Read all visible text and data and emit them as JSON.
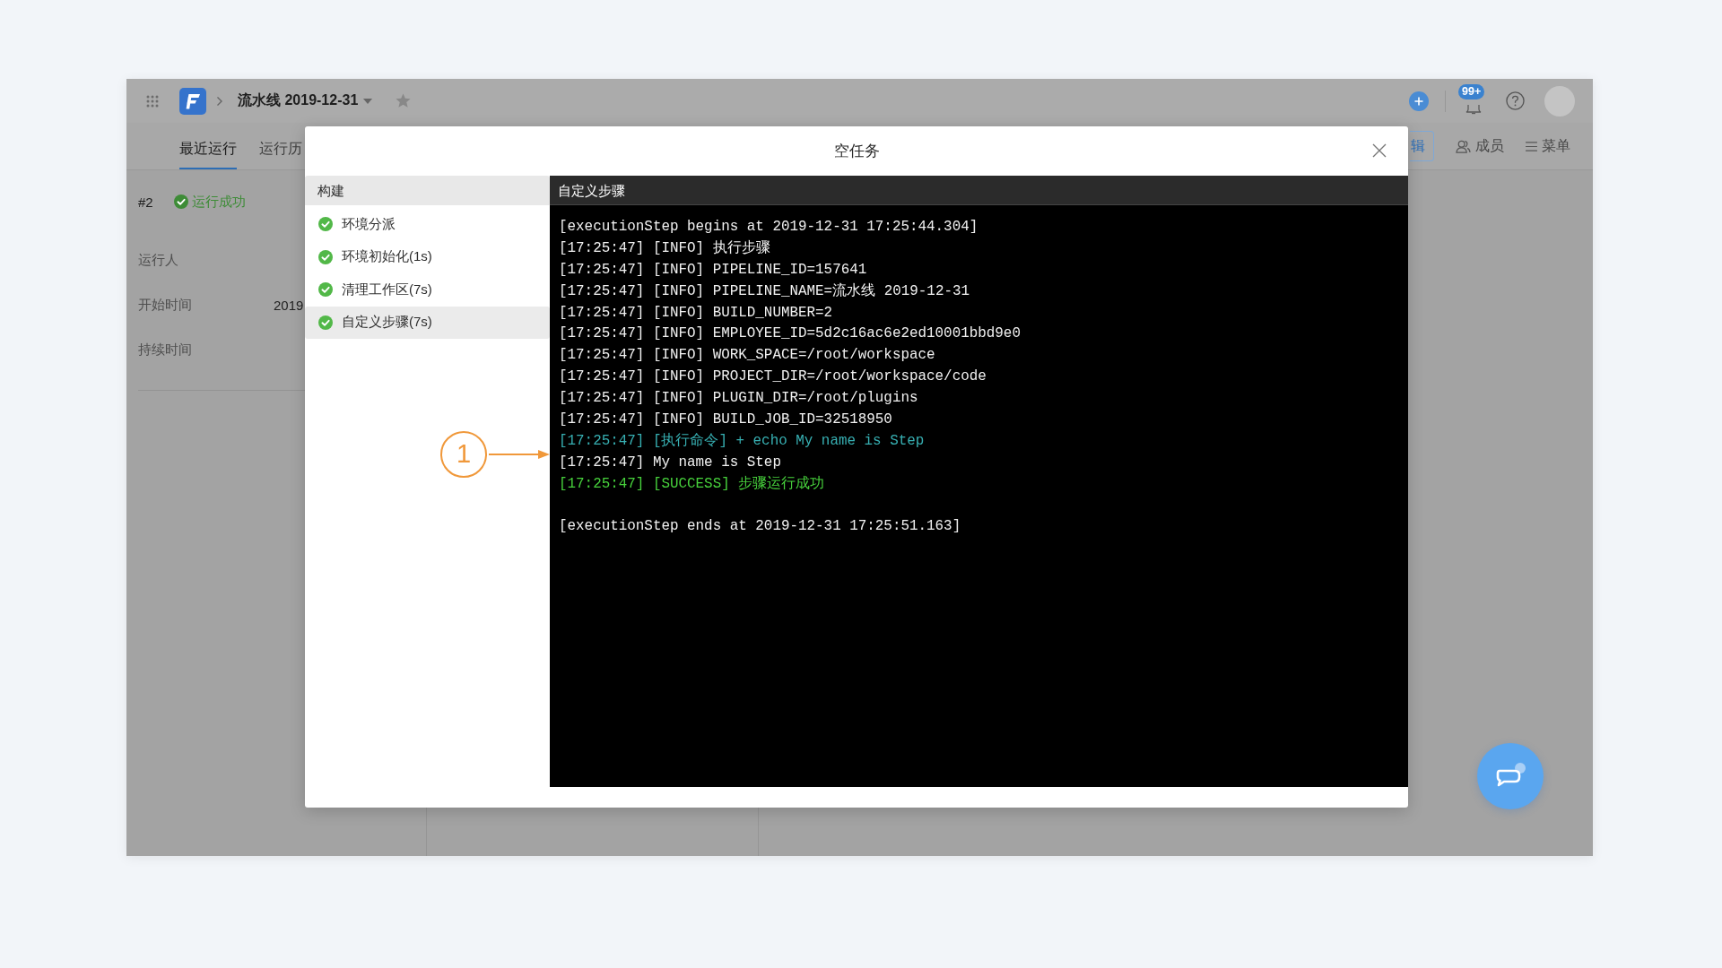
{
  "topbar": {
    "title": "流水线 2019-12-31",
    "notification_count": "99+"
  },
  "tabs": [
    {
      "label": "最近运行",
      "selected": true
    },
    {
      "label": "运行历",
      "selected": false
    }
  ],
  "actions": [
    {
      "kind": "edit",
      "label": "辑"
    },
    {
      "kind": "members",
      "label": "成员"
    },
    {
      "kind": "menu",
      "label": "菜单"
    }
  ],
  "run": {
    "number": "#2",
    "succeeded": true,
    "status_label": "运行成功",
    "fields": [
      {
        "label": "运行人"
      },
      {
        "label": "开始时间",
        "value": "2019"
      },
      {
        "label": "持续时间"
      }
    ]
  },
  "dialog": {
    "title": "空任务",
    "steps_header": "构建",
    "steps": [
      {
        "label": "环境分派",
        "succeeded": true,
        "selected": false
      },
      {
        "label": "环境初始化(1s)",
        "succeeded": true,
        "selected": false
      },
      {
        "label": "清理工作区(7s)",
        "succeeded": true,
        "selected": false
      },
      {
        "label": "自定义步骤(7s)",
        "succeeded": true,
        "selected": true
      }
    ],
    "log_title": "自定义步骤",
    "log": [
      {
        "kind": "plain",
        "text": "[executionStep begins at 2019-12-31 17:25:44.304]"
      },
      {
        "kind": "plain",
        "text": "[17:25:47] [INFO] 执行步骤"
      },
      {
        "kind": "plain",
        "text": "[17:25:47] [INFO] PIPELINE_ID=157641"
      },
      {
        "kind": "plain",
        "text": "[17:25:47] [INFO] PIPELINE_NAME=流水线 2019-12-31"
      },
      {
        "kind": "plain",
        "text": "[17:25:47] [INFO] BUILD_NUMBER=2"
      },
      {
        "kind": "plain",
        "text": "[17:25:47] [INFO] EMPLOYEE_ID=5d2c16ac6e2ed10001bbd9e0"
      },
      {
        "kind": "plain",
        "text": "[17:25:47] [INFO] WORK_SPACE=/root/workspace"
      },
      {
        "kind": "plain",
        "text": "[17:25:47] [INFO] PROJECT_DIR=/root/workspace/code"
      },
      {
        "kind": "plain",
        "text": "[17:25:47] [INFO] PLUGIN_DIR=/root/plugins"
      },
      {
        "kind": "plain",
        "text": "[17:25:47] [INFO] BUILD_JOB_ID=32518950"
      },
      {
        "kind": "command",
        "text": "[17:25:47] [执行命令] + echo My name is Step"
      },
      {
        "kind": "plain",
        "text": "[17:25:47] My name is Step"
      },
      {
        "kind": "success",
        "text": "[17:25:47] [SUCCESS] 步骤运行成功"
      },
      {
        "kind": "blank"
      },
      {
        "kind": "plain",
        "text": "[executionStep ends at 2019-12-31 17:25:51.163]"
      }
    ]
  },
  "callout": {
    "number": "1"
  }
}
